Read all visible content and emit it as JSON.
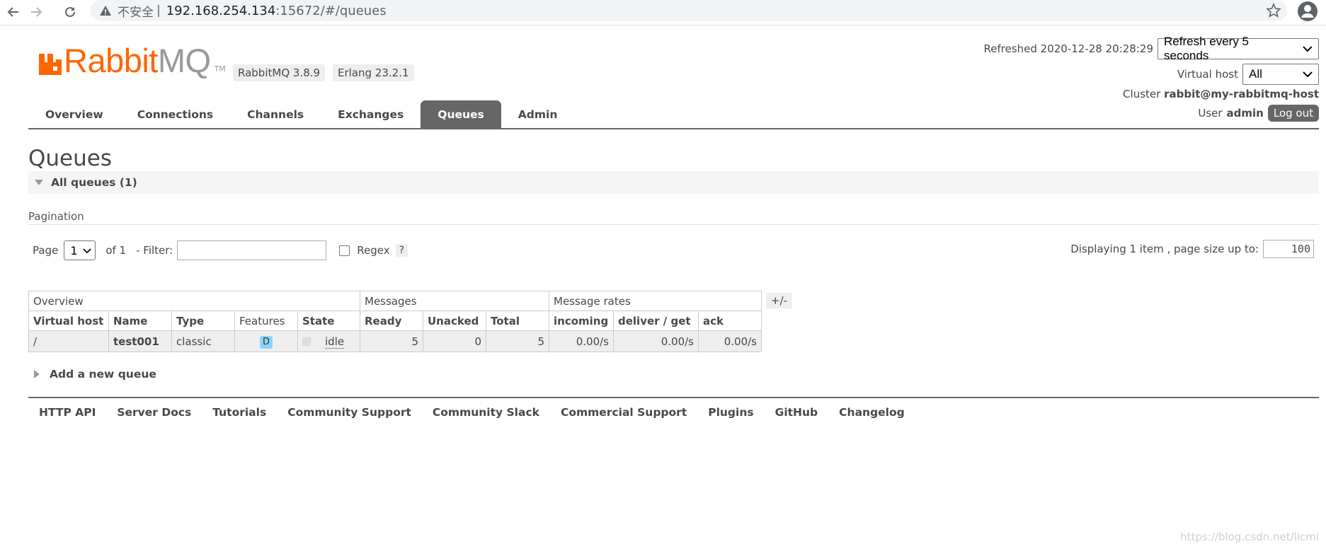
{
  "browser": {
    "insecure_label": "不安全",
    "separator": "|",
    "url_host": "192.168.254.134",
    "url_rest": ":15672/#/queues"
  },
  "header": {
    "brand_rabbit": "Rabbit",
    "brand_mq": "MQ",
    "brand_tm": "TM",
    "rabbitmq_version": "RabbitMQ 3.8.9",
    "erlang_version": "Erlang 23.2.1",
    "refreshed_label": "Refreshed 2020-12-28 20:28:29",
    "refresh_select": "Refresh every 5 seconds",
    "virtual_host_label": "Virtual host",
    "virtual_host_select": "All",
    "cluster_label": "Cluster",
    "cluster_name": "rabbit@my-rabbitmq-host",
    "user_label": "User",
    "user_name": "admin",
    "logout_label": "Log out"
  },
  "tabs": [
    {
      "label": "Overview"
    },
    {
      "label": "Connections"
    },
    {
      "label": "Channels"
    },
    {
      "label": "Exchanges"
    },
    {
      "label": "Queues",
      "active": true
    },
    {
      "label": "Admin"
    }
  ],
  "page": {
    "title": "Queues",
    "section_label": "All queues (1)",
    "pagination_label": "Pagination",
    "page_label": "Page",
    "page_select": "1",
    "of_label": "of 1",
    "filter_label": "- Filter:",
    "filter_value": "",
    "regex_label": "Regex",
    "help_label": "?",
    "displaying_label": "Displaying 1 item , page size up to:",
    "page_size": "100",
    "plus_minus": "+/-",
    "add_queue_label": "Add a new queue"
  },
  "table": {
    "groups": [
      "Overview",
      "Messages",
      "Message rates"
    ],
    "columns": [
      "Virtual host",
      "Name",
      "Type",
      "Features",
      "State",
      "Ready",
      "Unacked",
      "Total",
      "incoming",
      "deliver / get",
      "ack"
    ],
    "rows": [
      {
        "vhost": "/",
        "name": "test001",
        "type": "classic",
        "feature": "D",
        "state": "idle",
        "ready": "5",
        "unacked": "0",
        "total": "5",
        "incoming": "0.00/s",
        "deliver_get": "0.00/s",
        "ack": "0.00/s"
      }
    ]
  },
  "footer": {
    "links": [
      "HTTP API",
      "Server Docs",
      "Tutorials",
      "Community Support",
      "Community Slack",
      "Commercial Support",
      "Plugins",
      "GitHub",
      "Changelog"
    ]
  },
  "watermark": "https://blog.csdn.net/licmi",
  "colors": {
    "brand_orange": "#ff6600",
    "tab_active": "#666666",
    "feature_badge": "#8fd4ff"
  }
}
